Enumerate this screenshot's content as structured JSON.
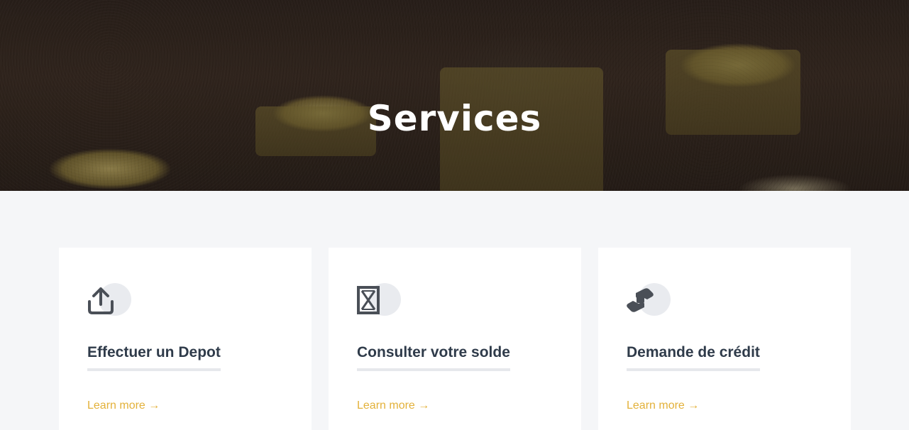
{
  "hero": {
    "title": "Services"
  },
  "services": [
    {
      "title": "Effectuer un Depot",
      "link_label": "Learn more →",
      "icon": "upload-icon"
    },
    {
      "title": "Consulter votre solde",
      "link_label": "Learn more →",
      "icon": "box-x-icon"
    },
    {
      "title": "Demande de crédit",
      "link_label": "Learn more →",
      "icon": "handshake-icon"
    }
  ],
  "colors": {
    "accent": "#e3b13a",
    "title": "#2f3b4a",
    "icon_bg": "#e9ebef",
    "page_bg": "#f5f6f8"
  }
}
